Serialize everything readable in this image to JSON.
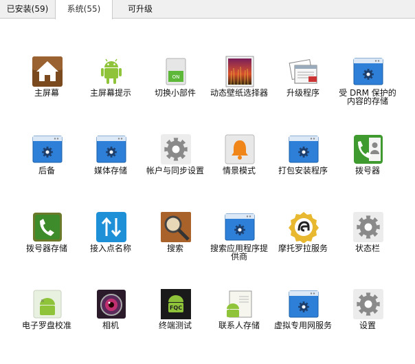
{
  "tabs": [
    {
      "label": "已安装(59)",
      "active": false
    },
    {
      "label": "系统(55)",
      "active": true
    },
    {
      "label": "可升级",
      "active": false
    }
  ],
  "apps": [
    {
      "label": "主屏幕",
      "icon": "home-icon"
    },
    {
      "label": "主屏幕提示",
      "icon": "android-robot-icon"
    },
    {
      "label": "切换小部件",
      "icon": "toggle-switch-icon"
    },
    {
      "label": "动态壁纸选择器",
      "icon": "live-wallpaper-icon"
    },
    {
      "label": "升级程序",
      "icon": "updater-icon"
    },
    {
      "label": "受 DRM 保护的内容的存储",
      "icon": "settings-window-icon"
    },
    {
      "label": "后备",
      "icon": "settings-window-icon"
    },
    {
      "label": "媒体存储",
      "icon": "settings-window-icon"
    },
    {
      "label": "帐户与同步设置",
      "icon": "gear-icon"
    },
    {
      "label": "情景模式",
      "icon": "bell-icon"
    },
    {
      "label": "打包安装程序",
      "icon": "settings-window-icon"
    },
    {
      "label": "拨号器",
      "icon": "phone-contacts-icon"
    },
    {
      "label": "拨号器存储",
      "icon": "phone-icon"
    },
    {
      "label": "接入点名称",
      "icon": "transfer-arrows-icon"
    },
    {
      "label": "搜索",
      "icon": "magnifier-icon"
    },
    {
      "label": "搜索应用程序提供商",
      "icon": "settings-window-icon"
    },
    {
      "label": "摩托罗拉服务",
      "icon": "motorola-icon"
    },
    {
      "label": "状态栏",
      "icon": "gear-icon"
    },
    {
      "label": "电子罗盘校准",
      "icon": "android-compass-icon"
    },
    {
      "label": "相机",
      "icon": "camera-icon"
    },
    {
      "label": "终端测试",
      "icon": "fqc-test-icon"
    },
    {
      "label": "联系人存储",
      "icon": "contacts-storage-icon"
    },
    {
      "label": "虚拟专用网服务",
      "icon": "settings-window-icon"
    },
    {
      "label": "设置",
      "icon": "gear-icon"
    }
  ],
  "colors": {
    "window_blue": "#2e7fd8",
    "gear_gray": "#8a8a8a",
    "android_green": "#8fc43a"
  }
}
